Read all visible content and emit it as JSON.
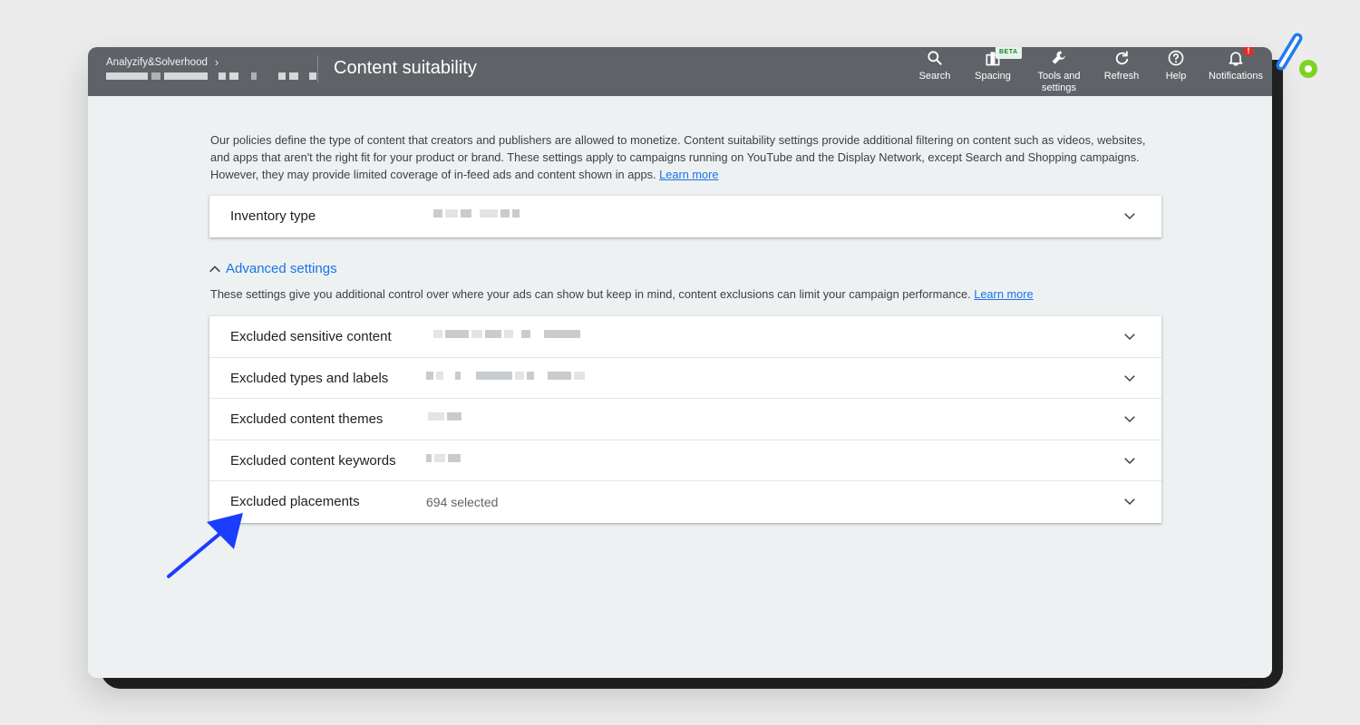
{
  "header": {
    "account_name": "Analyzify&Solverhood",
    "page_title": "Content suitability",
    "tools": [
      {
        "label": "Search",
        "icon": "search-icon"
      },
      {
        "label": "Spacing",
        "icon": "spacing-icon",
        "badge": "BETA"
      },
      {
        "label": "Tools and settings",
        "icon": "wrench-icon"
      },
      {
        "label": "Refresh",
        "icon": "refresh-icon"
      },
      {
        "label": "Help",
        "icon": "help-icon"
      },
      {
        "label": "Notifications",
        "icon": "bell-icon",
        "badge": "!"
      }
    ]
  },
  "intro": {
    "text": "Our policies define the type of content that creators and publishers are allowed to monetize. Content suitability settings provide additional filtering on content such as videos, websites, and apps that aren't the right fit for your product or brand. These settings apply to campaigns running on YouTube and the Display Network, except Search and Shopping campaigns. However, they may provide limited coverage of in-feed ads and content shown in apps.",
    "link": "Learn more"
  },
  "inventory": {
    "label": "Inventory type"
  },
  "advanced": {
    "toggle_label": "Advanced settings",
    "description": "These settings give you additional control over where your ads can show but keep in mind, content exclusions can limit your campaign performance.",
    "link": "Learn more",
    "rows": [
      {
        "label": "Excluded sensitive content",
        "value": ""
      },
      {
        "label": "Excluded types and labels",
        "value": ""
      },
      {
        "label": "Excluded content themes",
        "value": ""
      },
      {
        "label": "Excluded content keywords",
        "value": ""
      },
      {
        "label": "Excluded placements",
        "value": "694 selected"
      }
    ]
  },
  "colors": {
    "topbar": "#5f6368",
    "link": "#1a73e8",
    "arrow": "#1a3dff",
    "logo_blue": "#1f7cf2",
    "logo_green": "#7ed321"
  }
}
